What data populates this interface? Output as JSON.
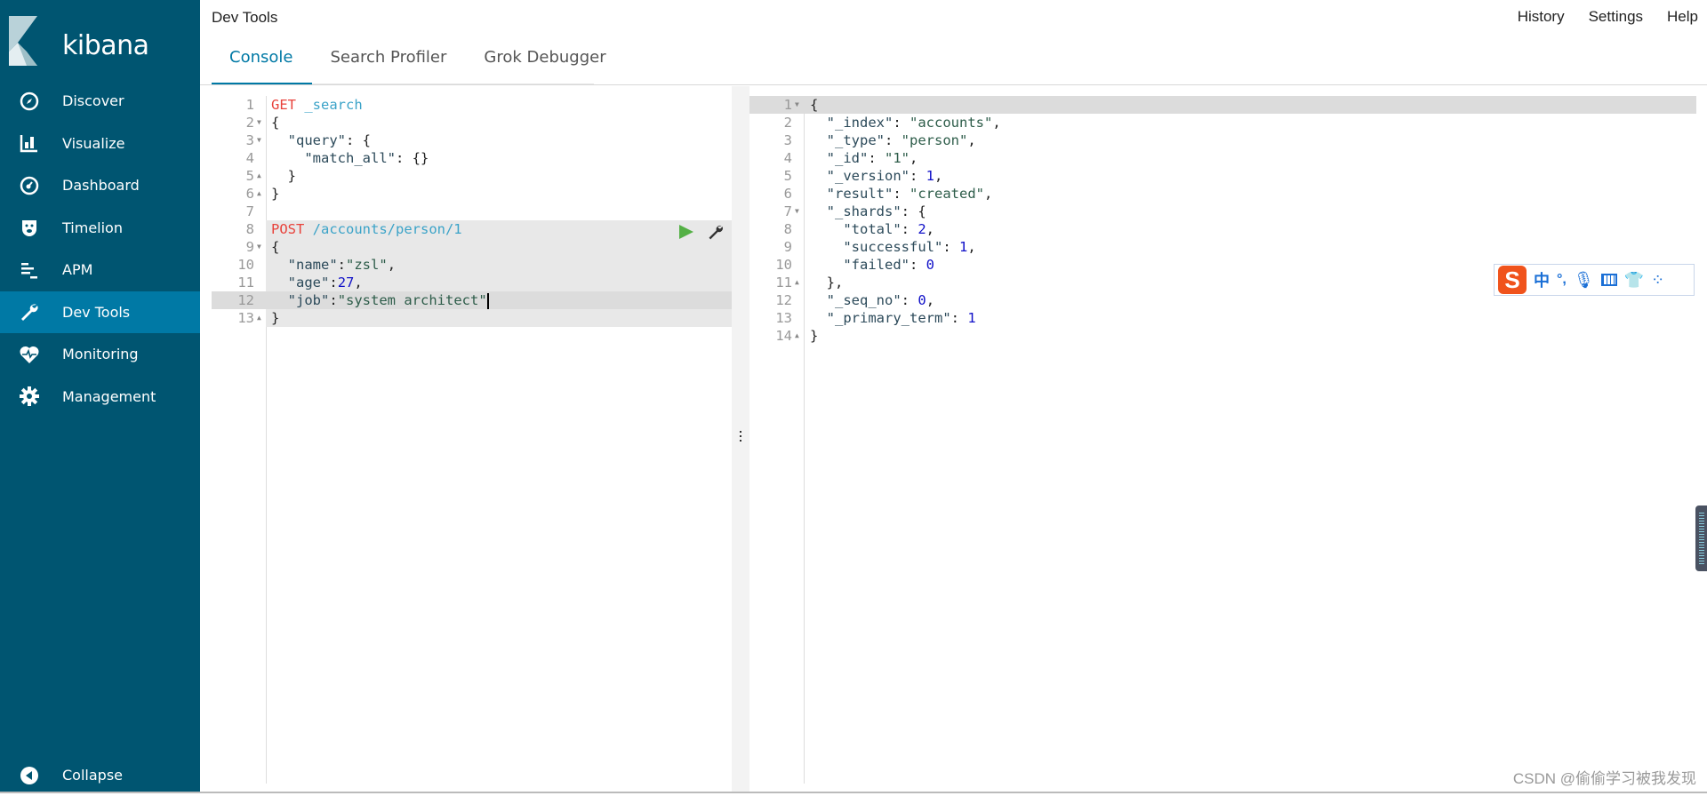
{
  "app": {
    "brand": "kibana",
    "page_title": "Dev Tools"
  },
  "colors": {
    "sidebar": "#005571",
    "active": "#0079a5",
    "method": "#e8433c",
    "url": "#3ba3c8",
    "number": "#1010c8",
    "run": "#54b045"
  },
  "sidebar": {
    "items": [
      {
        "label": "Discover",
        "icon": "compass-icon"
      },
      {
        "label": "Visualize",
        "icon": "bar-chart-icon"
      },
      {
        "label": "Dashboard",
        "icon": "dashboard-icon"
      },
      {
        "label": "Timelion",
        "icon": "timelion-bear-icon"
      },
      {
        "label": "APM",
        "icon": "apm-icon"
      },
      {
        "label": "Dev Tools",
        "icon": "wrench-icon",
        "active": true
      },
      {
        "label": "Monitoring",
        "icon": "heartbeat-icon"
      },
      {
        "label": "Management",
        "icon": "gear-icon"
      }
    ],
    "collapse": "Collapse"
  },
  "top_links": [
    "History",
    "Settings",
    "Help"
  ],
  "tabs": [
    {
      "label": "Console",
      "active": true
    },
    {
      "label": "Search Profiler"
    },
    {
      "label": "Grok Debugger"
    }
  ],
  "request_editor": {
    "lines": [
      [
        [
          "k-method",
          "GET"
        ],
        [
          "k-p",
          " "
        ],
        [
          "k-url",
          "_search"
        ]
      ],
      [
        [
          "k-p",
          "{"
        ]
      ],
      [
        [
          "k-p",
          "  "
        ],
        [
          "k-key",
          "\"query\""
        ],
        [
          "k-p",
          ": {"
        ]
      ],
      [
        [
          "k-p",
          "    "
        ],
        [
          "k-key",
          "\"match_all\""
        ],
        [
          "k-p",
          ": {}"
        ]
      ],
      [
        [
          "k-p",
          "  }"
        ]
      ],
      [
        [
          "k-p",
          "}"
        ]
      ],
      [],
      [
        [
          "k-method",
          "POST"
        ],
        [
          "k-p",
          " "
        ],
        [
          "k-url",
          "/accounts/person/1"
        ]
      ],
      [
        [
          "k-p",
          "{"
        ]
      ],
      [
        [
          "k-p",
          "  "
        ],
        [
          "k-key",
          "\"name\""
        ],
        [
          "k-p",
          ":"
        ],
        [
          "k-str",
          "\"zsl\""
        ],
        [
          "k-p",
          ","
        ]
      ],
      [
        [
          "k-p",
          "  "
        ],
        [
          "k-key",
          "\"age\""
        ],
        [
          "k-p",
          ":"
        ],
        [
          "k-num",
          "27"
        ],
        [
          "k-p",
          ","
        ]
      ],
      [
        [
          "k-p",
          "  "
        ],
        [
          "k-key",
          "\"job\""
        ],
        [
          "k-p",
          ":"
        ],
        [
          "k-str",
          "\"system architect\""
        ]
      ],
      [
        [
          "k-p",
          "}"
        ]
      ]
    ],
    "folds": {
      "2": "down",
      "3": "down",
      "5": "up",
      "6": "up",
      "9": "down",
      "13": "up"
    },
    "active_line": 12,
    "selected_block": [
      8,
      13
    ]
  },
  "response_editor": {
    "lines": [
      [
        [
          "k-p",
          "{"
        ]
      ],
      [
        [
          "k-p",
          "  "
        ],
        [
          "k-key",
          "\"_index\""
        ],
        [
          "k-p",
          ": "
        ],
        [
          "k-str",
          "\"accounts\""
        ],
        [
          "k-p",
          ","
        ]
      ],
      [
        [
          "k-p",
          "  "
        ],
        [
          "k-key",
          "\"_type\""
        ],
        [
          "k-p",
          ": "
        ],
        [
          "k-str",
          "\"person\""
        ],
        [
          "k-p",
          ","
        ]
      ],
      [
        [
          "k-p",
          "  "
        ],
        [
          "k-key",
          "\"_id\""
        ],
        [
          "k-p",
          ": "
        ],
        [
          "k-str",
          "\"1\""
        ],
        [
          "k-p",
          ","
        ]
      ],
      [
        [
          "k-p",
          "  "
        ],
        [
          "k-key",
          "\"_version\""
        ],
        [
          "k-p",
          ": "
        ],
        [
          "k-num",
          "1"
        ],
        [
          "k-p",
          ","
        ]
      ],
      [
        [
          "k-p",
          "  "
        ],
        [
          "k-key",
          "\"result\""
        ],
        [
          "k-p",
          ": "
        ],
        [
          "k-str",
          "\"created\""
        ],
        [
          "k-p",
          ","
        ]
      ],
      [
        [
          "k-p",
          "  "
        ],
        [
          "k-key",
          "\"_shards\""
        ],
        [
          "k-p",
          ": {"
        ]
      ],
      [
        [
          "k-p",
          "    "
        ],
        [
          "k-key",
          "\"total\""
        ],
        [
          "k-p",
          ": "
        ],
        [
          "k-num",
          "2"
        ],
        [
          "k-p",
          ","
        ]
      ],
      [
        [
          "k-p",
          "    "
        ],
        [
          "k-key",
          "\"successful\""
        ],
        [
          "k-p",
          ": "
        ],
        [
          "k-num",
          "1"
        ],
        [
          "k-p",
          ","
        ]
      ],
      [
        [
          "k-p",
          "    "
        ],
        [
          "k-key",
          "\"failed\""
        ],
        [
          "k-p",
          ": "
        ],
        [
          "k-num",
          "0"
        ]
      ],
      [
        [
          "k-p",
          "  },"
        ]
      ],
      [
        [
          "k-p",
          "  "
        ],
        [
          "k-key",
          "\"_seq_no\""
        ],
        [
          "k-p",
          ": "
        ],
        [
          "k-num",
          "0"
        ],
        [
          "k-p",
          ","
        ]
      ],
      [
        [
          "k-p",
          "  "
        ],
        [
          "k-key",
          "\"_primary_term\""
        ],
        [
          "k-p",
          ": "
        ],
        [
          "k-num",
          "1"
        ]
      ],
      [
        [
          "k-p",
          "}"
        ]
      ]
    ],
    "folds": {
      "1": "down",
      "7": "down",
      "11": "up",
      "14": "up"
    },
    "active_line": 1
  },
  "ime_toolbar": {
    "logo": "S",
    "mode": "中",
    "punct": "°,"
  },
  "watermark": "CSDN @偷偷学习被我发现"
}
